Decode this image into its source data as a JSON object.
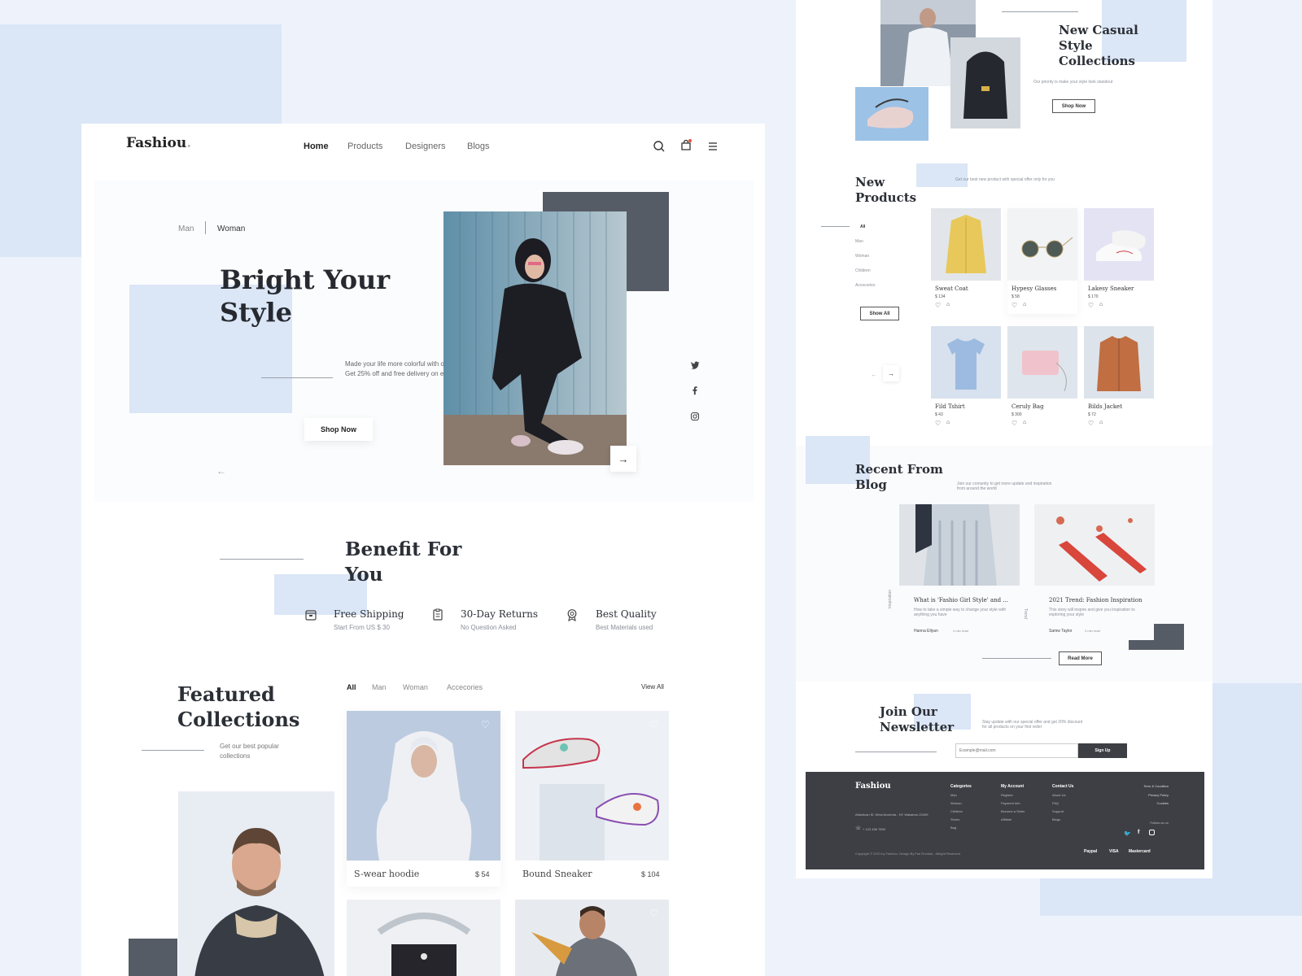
{
  "brand": "Fashiou",
  "nav": {
    "home": "Home",
    "products": "Products",
    "designers": "Designers",
    "blogs": "Blogs"
  },
  "hero": {
    "tab_man": "Man",
    "tab_woman": "Woman",
    "title_line1": "Bright Your",
    "title_line2": "Style",
    "description": "Made your life more colorful with our 2021 trend collections. Get 25% off and free delivery on every products.",
    "cta": "Shop Now"
  },
  "benefits": {
    "title_line1": "Benefit For",
    "title_line2": "You",
    "items": [
      {
        "title": "Free Shipping",
        "subtitle": "Start From US $ 30"
      },
      {
        "title": "30-Day Returns",
        "subtitle": "No Question Asked"
      },
      {
        "title": "Best Quality",
        "subtitle": "Best Materials used"
      }
    ]
  },
  "featured": {
    "title_line1": "Featured",
    "title_line2": "Collections",
    "subtitle": "Get our best popular collections",
    "filters": [
      "All",
      "Man",
      "Woman",
      "Accecories"
    ],
    "view_all": "View All",
    "products": [
      {
        "name": "S-wear hoodie",
        "price": "$ 54"
      },
      {
        "name": "Bound Sneaker",
        "price": "$ 104"
      }
    ]
  },
  "side": {
    "casual": {
      "title_line1": "New Casual",
      "title_line2": "Style",
      "title_line3": "Collections",
      "subtitle": "Our priority is make your style look standout",
      "cta": "Shop Now"
    },
    "new_products": {
      "title_line1": "New",
      "title_line2": "Products",
      "subtitle": "Get our best new product with special offer only for you",
      "categories": [
        "All",
        "Man",
        "Woman",
        "Children",
        "Accecories"
      ],
      "show_all": "Show All",
      "items": [
        {
          "name": "Sweat Coat",
          "price": "$ 134"
        },
        {
          "name": "Hypesy Glasses",
          "price": "$ 58"
        },
        {
          "name": "Lakesy Sneaker",
          "price": "$ 170"
        },
        {
          "name": "Fild Tshirt",
          "price": "$ 43"
        },
        {
          "name": "Ceruly Bag",
          "price": "$ 300"
        },
        {
          "name": "Bilds Jacket",
          "price": "$ 72"
        }
      ]
    },
    "blog": {
      "title_line1": "Recent From",
      "title_line2": "Blog",
      "subtitle": "Join our comunity to get more update and inspiration from around the world",
      "posts": [
        {
          "tag": "Inspiration",
          "title": "What is 'Fashio Girl Style' and ...",
          "excerpt": "How to take a simple way to change your style with anything you have",
          "author": "Hanna Ellyan",
          "read": "4 min read"
        },
        {
          "tag": "Trend",
          "title": "2021 Trend: Fashion Inspiration",
          "excerpt": "This story will inspire and give you inspiration to exploring your style",
          "author": "Samw Taylor",
          "read": "3 min read"
        }
      ],
      "read_more": "Read More"
    },
    "newsletter": {
      "title_line1": "Join Our",
      "title_line2": "Newsletter",
      "subtitle": "Stay update with our special offer and get 20% discount for all products on your first order",
      "placeholder": "Example@mail.com",
      "button": "Sign Up"
    },
    "footer": {
      "brand": "Fashiou",
      "address": "Atlantican St. West Ancienta - NY Wakatoru 22409",
      "phone": "+ 123 456 7890",
      "categories_title": "Categories",
      "categories": [
        "Man",
        "Woman",
        "Children",
        "Shoes",
        "Bag"
      ],
      "account_title": "My Account",
      "account": [
        "Register",
        "Payment Info",
        "Become a Seller",
        "Affiliate"
      ],
      "contact_title": "Contact Us",
      "contact": [
        "About Us",
        "FAQ",
        "Support",
        "Blogs"
      ],
      "legal": [
        "Term & Condition",
        "Privacy Policy",
        "Cookies"
      ],
      "follow": "Follow us on",
      "copyright": "Copyright © 2021 by Fashiou. Design By Fari Rumbai - Allright Reserved",
      "payments": [
        "Paypal",
        "VISA",
        "Mastercard"
      ]
    }
  },
  "colors": {
    "accent_blue": "#dbe6f6",
    "dark_block": "#565c66",
    "footer_bg": "#3d3f44",
    "text": "#2b2f36"
  }
}
